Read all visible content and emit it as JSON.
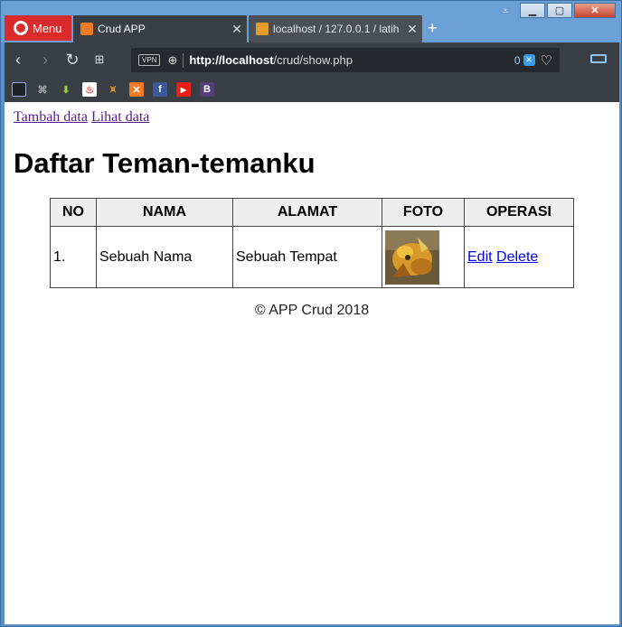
{
  "browser": {
    "menu_label": "Menu",
    "tabs": [
      {
        "title": "Crud APP",
        "icon": "xampp-icon",
        "active": true
      },
      {
        "title": "localhost / 127.0.0.1 / latih",
        "icon": "phpmyadmin-icon",
        "active": false
      }
    ],
    "url_host": "http://localhost",
    "url_path": "/crud/show.php",
    "vpn_label": "VPN",
    "adblock_count": "0",
    "bookmarks": [
      "bookmark-icon",
      "pdf-icon",
      "download-icon",
      "fire-icon",
      "phpmyadmin-icon",
      "xampp-icon",
      "facebook-icon",
      "youtube-icon",
      "bootstrap-icon"
    ]
  },
  "page": {
    "nav": {
      "add_link": "Tambah data",
      "view_link": "Lihat data"
    },
    "title": "Daftar Teman-temanku",
    "table": {
      "headers": [
        "NO",
        "NAMA",
        "ALAMAT",
        "FOTO",
        "OPERASI"
      ],
      "rows": [
        {
          "no": "1.",
          "nama": "Sebuah Nama",
          "alamat": "Sebuah Tempat",
          "edit": "Edit",
          "delete": "Delete"
        }
      ]
    },
    "footer": "© APP Crud 2018"
  }
}
